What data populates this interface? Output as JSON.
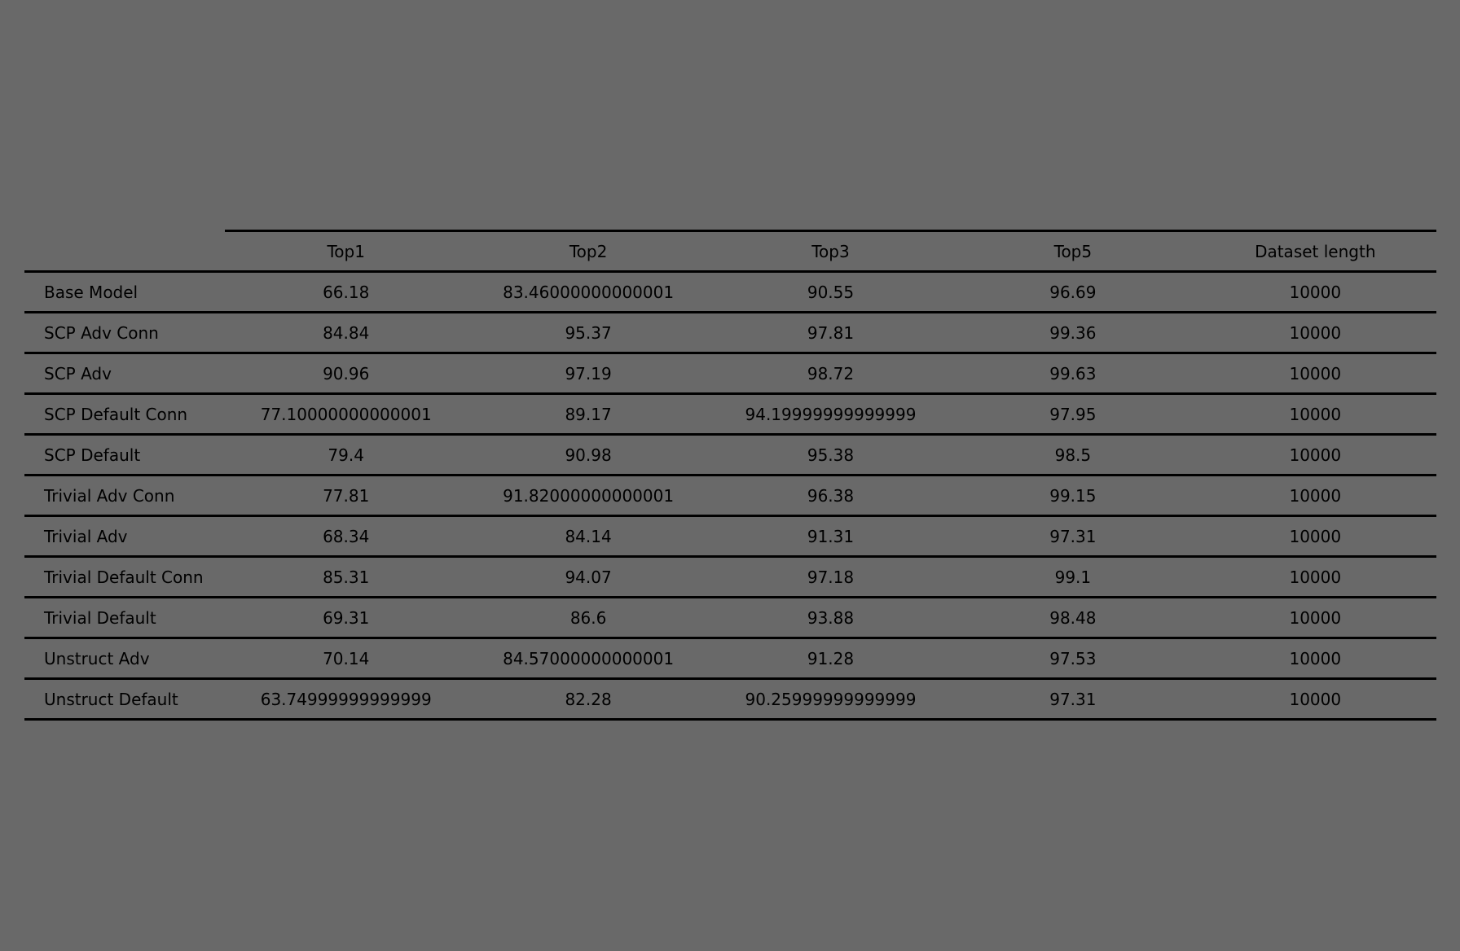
{
  "chart_data": {
    "type": "table",
    "columns": [
      "Top1",
      "Top2",
      "Top3",
      "Top5",
      "Dataset length"
    ],
    "rows": [
      {
        "label": "Base Model",
        "values": [
          "66.18",
          "83.46000000000001",
          "90.55",
          "96.69",
          "10000"
        ]
      },
      {
        "label": "SCP Adv Conn",
        "values": [
          "84.84",
          "95.37",
          "97.81",
          "99.36",
          "10000"
        ]
      },
      {
        "label": "SCP Adv",
        "values": [
          "90.96",
          "97.19",
          "98.72",
          "99.63",
          "10000"
        ]
      },
      {
        "label": "SCP Default Conn",
        "values": [
          "77.10000000000001",
          "89.17",
          "94.19999999999999",
          "97.95",
          "10000"
        ]
      },
      {
        "label": "SCP Default",
        "values": [
          "79.4",
          "90.98",
          "95.38",
          "98.5",
          "10000"
        ]
      },
      {
        "label": "Trivial Adv Conn",
        "values": [
          "77.81",
          "91.82000000000001",
          "96.38",
          "99.15",
          "10000"
        ]
      },
      {
        "label": "Trivial Adv",
        "values": [
          "68.34",
          "84.14",
          "91.31",
          "97.31",
          "10000"
        ]
      },
      {
        "label": "Trivial Default Conn",
        "values": [
          "85.31",
          "94.07",
          "97.18",
          "99.1",
          "10000"
        ]
      },
      {
        "label": "Trivial Default",
        "values": [
          "69.31",
          "86.6",
          "93.88",
          "98.48",
          "10000"
        ]
      },
      {
        "label": "Unstruct Adv",
        "values": [
          "70.14",
          "84.57000000000001",
          "91.28",
          "97.53",
          "10000"
        ]
      },
      {
        "label": "Unstruct Default",
        "values": [
          "63.74999999999999",
          "82.28",
          "90.25999999999999",
          "97.31",
          "10000"
        ]
      }
    ]
  },
  "colors": {
    "background": "#696969",
    "text": "#000000",
    "rules": "#000000"
  }
}
